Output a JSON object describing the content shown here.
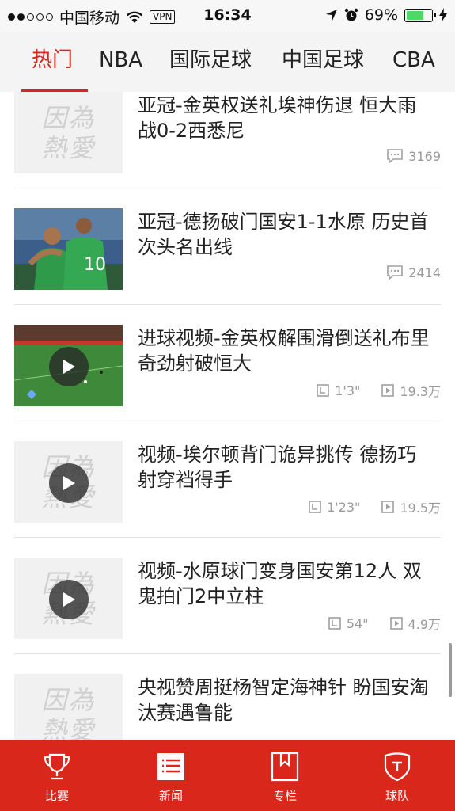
{
  "status_bar": {
    "carrier": "中国移动",
    "vpn": "VPN",
    "time": "16:34",
    "battery": "69%",
    "battery_level": 0.69
  },
  "tabs": [
    {
      "label": "热门",
      "active": true
    },
    {
      "label": "NBA",
      "active": false
    },
    {
      "label": "国际足球",
      "active": false
    },
    {
      "label": "中国足球",
      "active": false
    },
    {
      "label": "CBA",
      "active": false
    }
  ],
  "news": [
    {
      "title": "亚冠-金英权送礼埃神伤退 恒大雨战0-2西悉尼",
      "thumb": "placeholder",
      "comments": "3169"
    },
    {
      "title": "亚冠-德扬破门国安1-1水原 历史首次头名出线",
      "thumb": "photo",
      "comments": "2414"
    },
    {
      "title": "进球视频-金英权解围滑倒送礼布里奇劲射破恒大",
      "thumb": "video-photo",
      "duration": "1'3\"",
      "plays": "19.3万"
    },
    {
      "title": "视频-埃尔顿背门诡异挑传 德扬巧射穿裆得手",
      "thumb": "video-placeholder",
      "duration": "1'23\"",
      "plays": "19.5万"
    },
    {
      "title": "视频-水原球门变身国安第12人 双鬼拍门2中立柱",
      "thumb": "video-placeholder",
      "duration": "54\"",
      "plays": "4.9万"
    },
    {
      "title": "央视赞周挺杨智定海神针 盼国安淘汰赛遇鲁能",
      "thumb": "placeholder"
    }
  ],
  "placeholder_text": {
    "line1": "因為",
    "line2": "熱愛"
  },
  "bottom_nav": [
    {
      "label": "比赛",
      "icon": "trophy-icon"
    },
    {
      "label": "新闻",
      "icon": "news-icon"
    },
    {
      "label": "专栏",
      "icon": "bookmark-icon"
    },
    {
      "label": "球队",
      "icon": "shield-icon"
    }
  ],
  "colors": {
    "accent": "#d9261c",
    "nav_bg": "#d9271c",
    "battery": "#4cd964"
  }
}
